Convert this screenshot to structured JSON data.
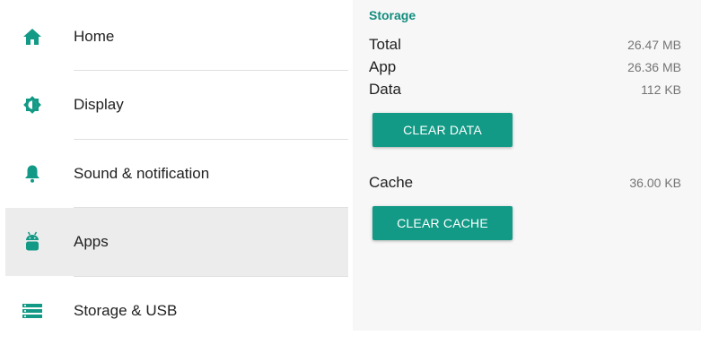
{
  "colors": {
    "accent": "#129a86",
    "section_title": "#128c7e",
    "selected_bg": "#ececec"
  },
  "nav": {
    "items": [
      {
        "label": "Home",
        "icon": "home-icon",
        "selected": false
      },
      {
        "label": "Display",
        "icon": "brightness-icon",
        "selected": false
      },
      {
        "label": "Sound & notification",
        "icon": "bell-icon",
        "selected": false
      },
      {
        "label": "Apps",
        "icon": "android-icon",
        "selected": true
      },
      {
        "label": "Storage & USB",
        "icon": "storage-icon",
        "selected": false
      }
    ]
  },
  "storage": {
    "title": "Storage",
    "rows": [
      {
        "label": "Total",
        "value": "26.47 MB"
      },
      {
        "label": "App",
        "value": "26.36 MB"
      },
      {
        "label": "Data",
        "value": "112 KB"
      }
    ],
    "clear_data_label": "CLEAR DATA",
    "cache": {
      "label": "Cache",
      "value": "36.00 KB"
    },
    "clear_cache_label": "CLEAR CACHE"
  }
}
